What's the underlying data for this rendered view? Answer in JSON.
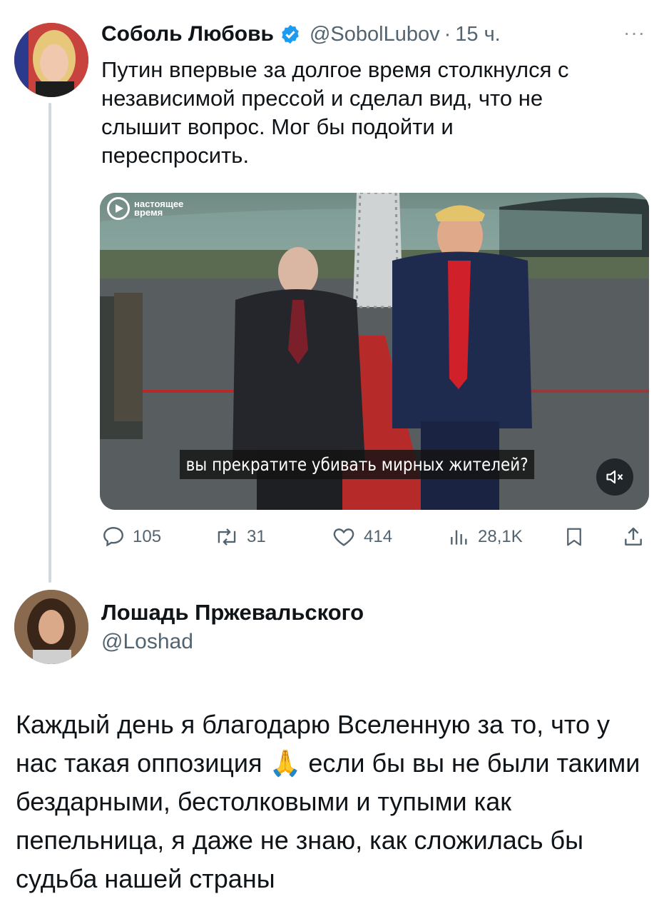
{
  "tweet": {
    "author_name": "Соболь Любовь",
    "handle": "@SobolLubov",
    "separator": "·",
    "time": "15 ч.",
    "more_label": "···",
    "text": "Путин впервые за долгое время столкнулся с\nнезависимой прессой и сделал вид, что не\nслышит вопрос. Мог бы подойти и\nпереспросить.",
    "media": {
      "logo_line1": "настоящее",
      "logo_line2": "время",
      "subtitle": "вы прекратите убивать мирных жителей?",
      "mute_icon": "mute-icon"
    },
    "stats": {
      "replies": "105",
      "reposts": "31",
      "likes": "414",
      "views": "28,1K"
    },
    "accent_color": "#1d9bf0"
  },
  "reply": {
    "author_name": "Лошадь Пржевальского",
    "handle": "@Loshad",
    "text_before_emoji": "Каждый день я благодарю Вселенную за то, что у нас такая оппозиция ",
    "emoji": "🙏",
    "text_after_emoji": " если бы вы не были такими бездарными, бестолковыми и тупыми как пепельница, я даже не знаю, как сложилась бы судьба нашей страны"
  }
}
